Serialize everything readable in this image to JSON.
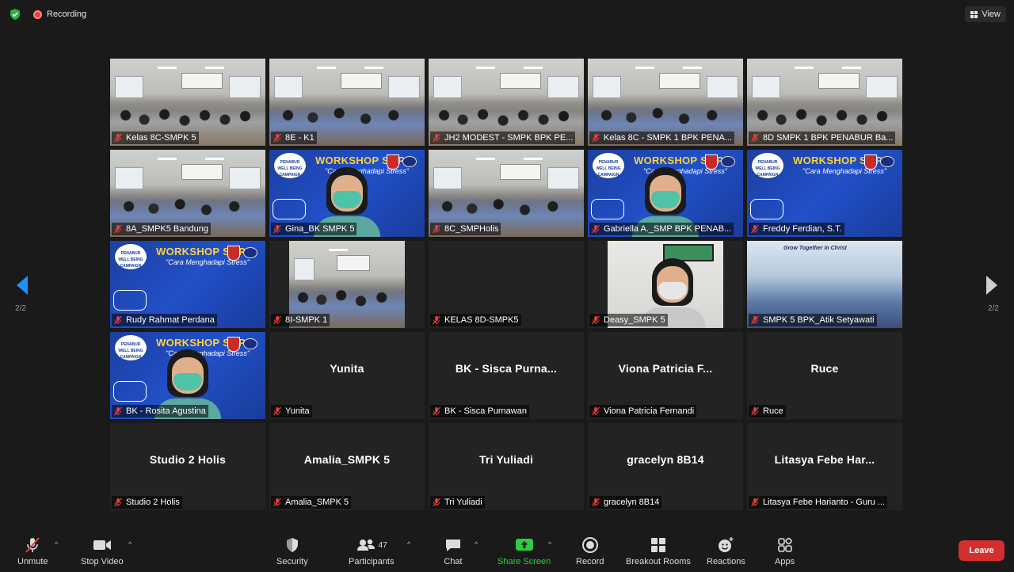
{
  "topbar": {
    "recording_label": "Recording",
    "view_label": "View"
  },
  "pagination": {
    "left": "2/2",
    "right": "2/2"
  },
  "tiles": [
    {
      "name": "Kelas 8C-SMPK 5",
      "display": "",
      "kind": "classroom"
    },
    {
      "name": "8E - K1",
      "display": "",
      "kind": "classroom"
    },
    {
      "name": "JH2 MODEST - SMPK BPK PE...",
      "display": "",
      "kind": "classroom"
    },
    {
      "name": "Kelas 8C - SMPK 1 BPK PENA...",
      "display": "",
      "kind": "classroom"
    },
    {
      "name": "8D SMPK 1 BPK PENABUR Ba...",
      "display": "",
      "kind": "classroom"
    },
    {
      "name": "8A_SMPK5 Bandung",
      "display": "",
      "kind": "classroom"
    },
    {
      "name": "Gina_BK SMPK 5",
      "display": "",
      "kind": "banner-person"
    },
    {
      "name": "8C_SMPHolis",
      "display": "",
      "kind": "classroom"
    },
    {
      "name": "Gabriella A._SMP BPK PENAB...",
      "display": "",
      "kind": "banner-person"
    },
    {
      "name": "Freddy Ferdian, S.T.",
      "display": "",
      "kind": "banner"
    },
    {
      "name": "Rudy Rahmat Perdana",
      "display": "",
      "kind": "banner"
    },
    {
      "name": "8I-SMPK 1",
      "display": "",
      "kind": "classroom-boxed"
    },
    {
      "name": "KELAS 8D-SMPK5",
      "display": "",
      "kind": "blank"
    },
    {
      "name": "Deasy_SMPK 5",
      "display": "",
      "kind": "person-boxed"
    },
    {
      "name": "SMPK 5 BPK_Atik Setyawati",
      "display": "",
      "kind": "digital"
    },
    {
      "name": "BK - Rosita Agustina",
      "display": "",
      "kind": "banner-person"
    },
    {
      "name": "Yunita",
      "display": "Yunita",
      "kind": "blank"
    },
    {
      "name": "BK - Sisca Purnawan",
      "display": "BK - Sisca Purna...",
      "kind": "blank"
    },
    {
      "name": "Viona Patricia Fernandi",
      "display": "Viona Patricia F...",
      "kind": "blank"
    },
    {
      "name": "Ruce",
      "display": "Ruce",
      "kind": "blank"
    },
    {
      "name": "Studio 2 Holis",
      "display": "Studio 2 Holis",
      "kind": "blank"
    },
    {
      "name": "Amalia_SMPK 5",
      "display": "Amalia_SMPK 5",
      "kind": "blank"
    },
    {
      "name": "Tri Yuliadi",
      "display": "Tri Yuliadi",
      "kind": "blank"
    },
    {
      "name": "gracelyn 8B14",
      "display": "gracelyn 8B14",
      "kind": "blank"
    },
    {
      "name": "Litasya Febe Harianto - Guru ...",
      "display": "Litasya Febe Har...",
      "kind": "blank"
    }
  ],
  "banner": {
    "title": "WORKSHOP SMP",
    "subtitle": "\"Cara Menghadapi Stress\"",
    "logo_text": "PENABUR WELL BEING CAMPAIGN"
  },
  "digital_text": "Grow Together in Christ",
  "toolbar": {
    "unmute": "Unmute",
    "stop_video": "Stop Video",
    "security": "Security",
    "participants": "Participants",
    "participants_count": "47",
    "chat": "Chat",
    "share_screen": "Share Screen",
    "record": "Record",
    "breakout_rooms": "Breakout Rooms",
    "reactions": "Reactions",
    "apps": "Apps",
    "leave": "Leave"
  },
  "colors": {
    "background": "#1a1a1a",
    "tile_blank": "#232323",
    "muted_mic": "#e8413a",
    "share_green": "#2ecc40",
    "leave_red": "#d32f2f",
    "nav_arrow": "#1e90ff"
  }
}
